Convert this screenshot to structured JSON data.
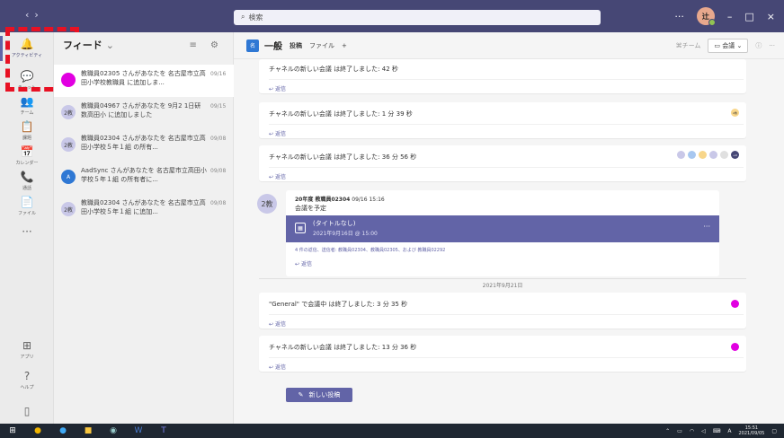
{
  "titlebar": {
    "back": "‹",
    "forward": "›",
    "search_placeholder": "検索",
    "more": "···",
    "avatar_initials": "辻",
    "minimize": "–",
    "maximize": "□",
    "close": "×"
  },
  "rail": [
    {
      "name": "activity",
      "label": "アクティビティ",
      "icon": "🔔"
    },
    {
      "name": "chat",
      "label": "チャット",
      "icon": "💬"
    },
    {
      "name": "teams",
      "label": "チーム",
      "icon": "👥"
    },
    {
      "name": "assignments",
      "label": "課題",
      "icon": "📋"
    },
    {
      "name": "calendar",
      "label": "カレンダー",
      "icon": "📅"
    },
    {
      "name": "calls",
      "label": "通話",
      "icon": "📞"
    },
    {
      "name": "files",
      "label": "ファイル",
      "icon": "📄"
    },
    {
      "name": "more",
      "label": "",
      "icon": "···"
    },
    {
      "name": "apps",
      "label": "アプリ",
      "icon": "⊞"
    },
    {
      "name": "help",
      "label": "ヘルプ",
      "icon": "?"
    }
  ],
  "activity": {
    "title": "フィード",
    "items": [
      {
        "avatar": "",
        "text": "教職員02305 さんがあなたを 名古屋市立高田小学校教職員 に追加しま...",
        "date": "09/16"
      },
      {
        "avatar": "2教",
        "text": "教職員04967 さんがあなたを 9月2 1日研数高田小 に追加しました",
        "date": "09/15"
      },
      {
        "avatar": "2教",
        "text": "教職員02304 さんがあなたを 名古屋市立高田小学校５年１組 の所有...",
        "date": "09/08"
      },
      {
        "avatar": "A",
        "text": "AadSync さんがあなたを 名古屋市立高田小学校５年１組 の所有者に...",
        "date": "09/08"
      },
      {
        "avatar": "2教",
        "text": "教職員02304 さんがあなたを 名古屋市立高田小学校５年１組 に追加...",
        "date": "09/08"
      }
    ]
  },
  "channel": {
    "badge": "名",
    "name": "一般",
    "tabs": [
      "投稿",
      "ファイル",
      "+"
    ],
    "team_label": "チーム",
    "meet": "会議"
  },
  "messages": [
    {
      "text": "チャネルの新しい会議 は終了しました: 42 秒",
      "reply": "返信"
    },
    {
      "text": "チャネルの新しい会議 は終了しました: 1 分 39 秒",
      "reply": "返信",
      "badge": "2教"
    },
    {
      "text": "チャネルの新しい会議 は終了しました: 36 分 56 秒",
      "reply": "返信",
      "more_count": "+9"
    },
    {
      "text": "\"General\" で会議中 は終了しました: 3 分 35 秒",
      "reply": "返信"
    },
    {
      "text": "チャネルの新しい会議 は終了しました: 13 分 36 秒",
      "reply": "返信"
    }
  ],
  "post": {
    "avatar": "2教",
    "author": "20年度 教職員02304",
    "time": "09/16 15:16",
    "subject": "会議を予定",
    "event_title": "(タイトルなし)",
    "event_time": "2021年9月16日 @ 15:00",
    "replies": "4 件の返信、送信者: 教職員02304、教職員02305、および 教職員02292",
    "reply": "返信"
  },
  "date_separator": "2021年9月21日",
  "new_post": "新しい投稿",
  "clock": {
    "time": "15:51",
    "date": "2021/09/05"
  }
}
